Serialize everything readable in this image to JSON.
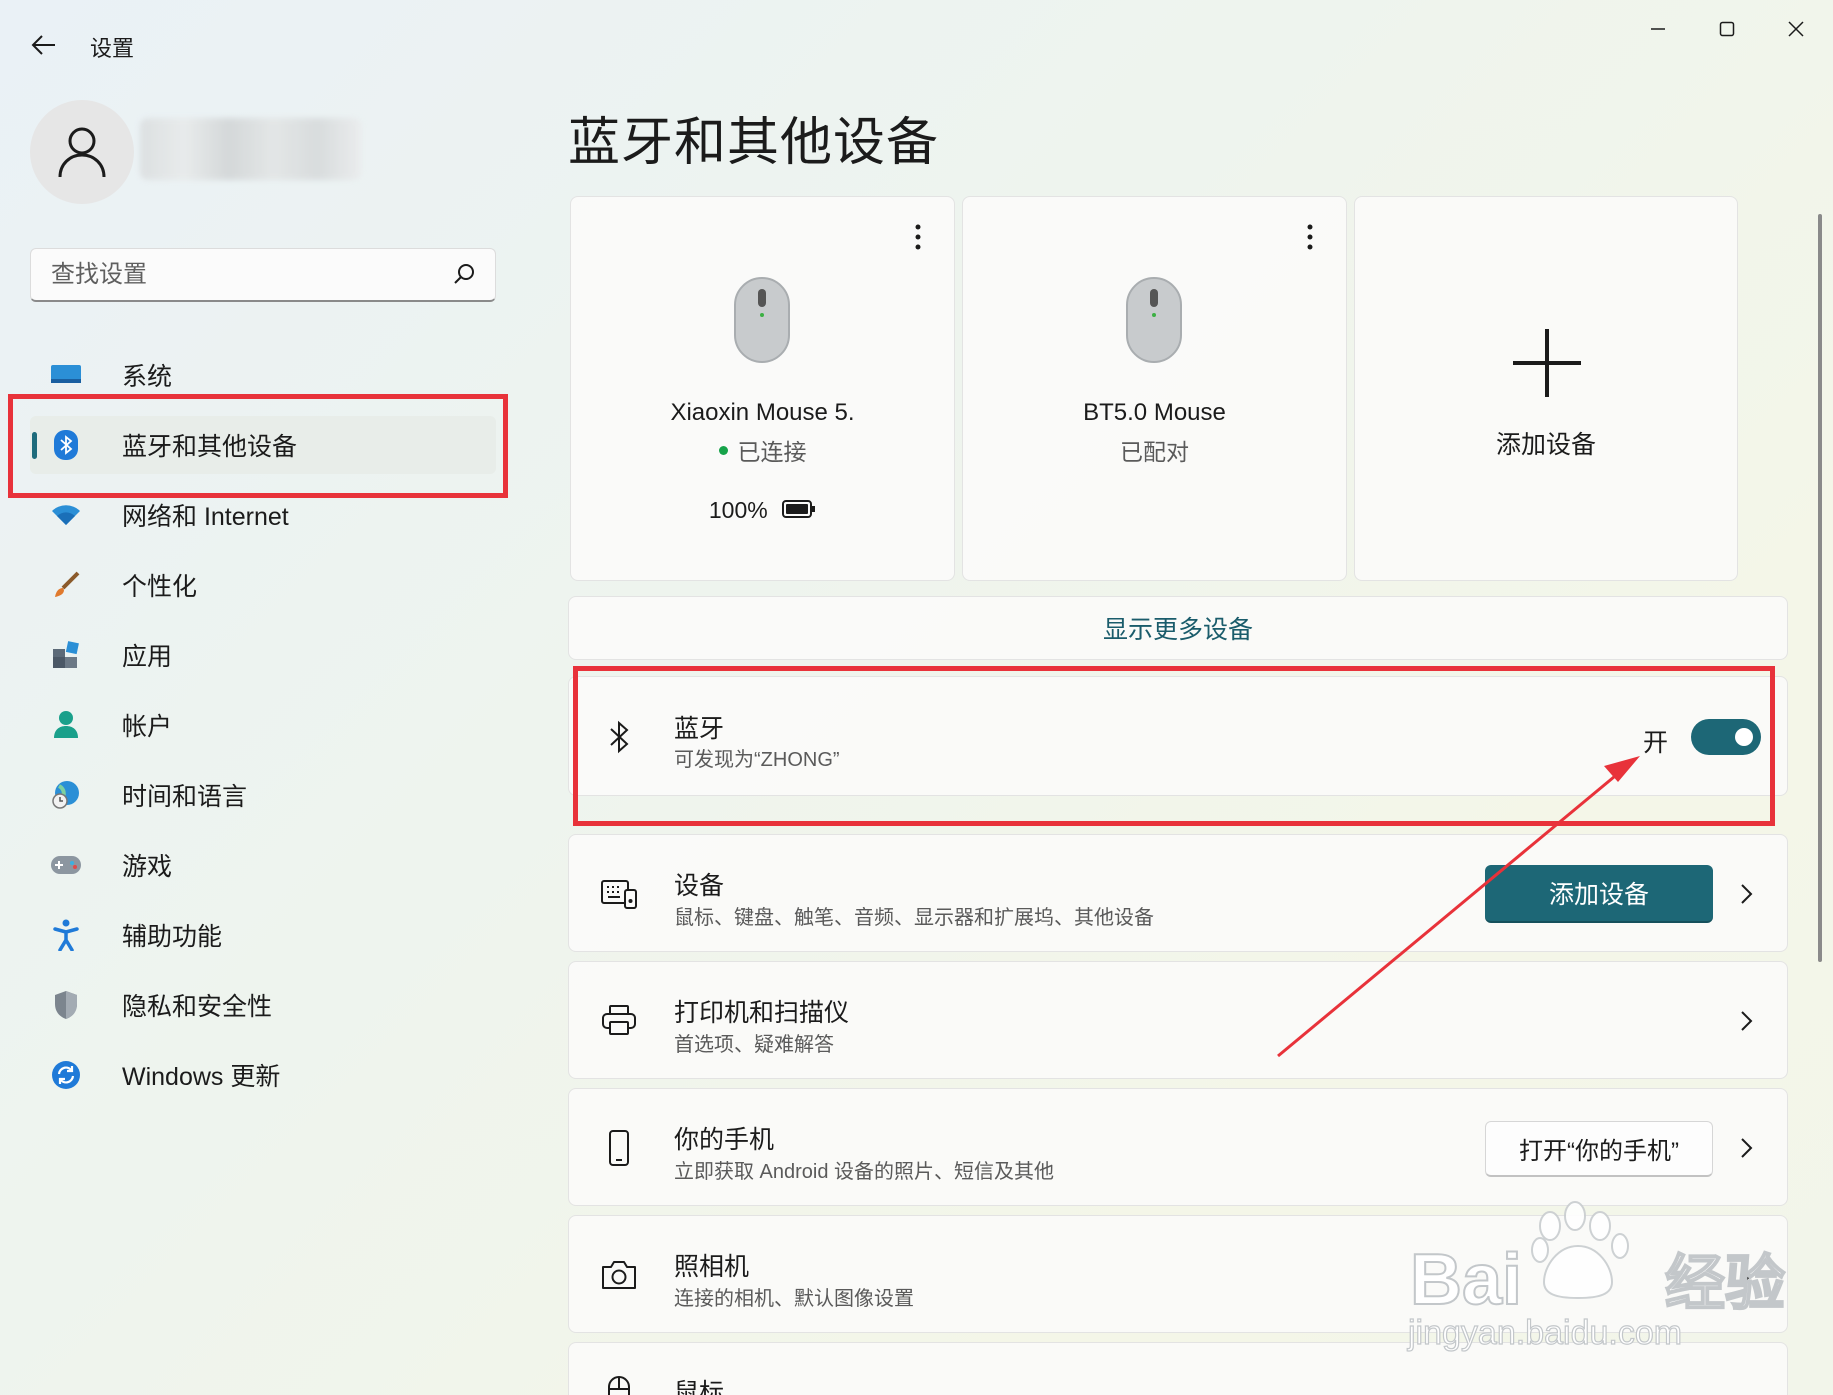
{
  "window": {
    "app_title": "设置",
    "back_icon": "arrow-left-icon",
    "controls": [
      "minimize-icon",
      "maximize-icon",
      "close-icon"
    ]
  },
  "user": {
    "avatar_icon": "person-icon"
  },
  "search": {
    "placeholder": "查找设置",
    "icon": "search-icon"
  },
  "sidebar": {
    "items": [
      {
        "label": "系统",
        "icon": "monitor-icon"
      },
      {
        "label": "蓝牙和其他设备",
        "icon": "bluetooth-icon",
        "active": true
      },
      {
        "label": "网络和 Internet",
        "icon": "wifi-icon"
      },
      {
        "label": "个性化",
        "icon": "brush-icon"
      },
      {
        "label": "应用",
        "icon": "apps-icon"
      },
      {
        "label": "帐户",
        "icon": "account-icon"
      },
      {
        "label": "时间和语言",
        "icon": "globe-clock-icon"
      },
      {
        "label": "游戏",
        "icon": "gamepad-icon"
      },
      {
        "label": "辅助功能",
        "icon": "accessibility-icon"
      },
      {
        "label": "隐私和安全性",
        "icon": "shield-icon"
      },
      {
        "label": "Windows 更新",
        "icon": "update-icon"
      }
    ]
  },
  "page": {
    "title": "蓝牙和其他设备"
  },
  "devices": [
    {
      "name": "Xiaoxin Mouse 5.",
      "status": "已连接",
      "battery": "100%",
      "status_dot_color": "#16a34a",
      "icon": "mouse-icon"
    },
    {
      "name": "BT5.0 Mouse",
      "status": "已配对",
      "icon": "mouse-icon"
    }
  ],
  "add_device_tile": {
    "label": "添加设备",
    "icon": "plus-icon"
  },
  "show_more": {
    "label": "显示更多设备"
  },
  "bluetooth": {
    "title": "蓝牙",
    "subtitle": "可发现为“ZHONG”",
    "state_label": "开",
    "on": true,
    "icon": "bluetooth-icon"
  },
  "rows": [
    {
      "title": "设备",
      "subtitle": "鼠标、键盘、触笔、音频、显示器和扩展坞、其他设备",
      "button": "添加设备",
      "icon": "keyboard-icon"
    },
    {
      "title": "打印机和扫描仪",
      "subtitle": "首选项、疑难解答",
      "icon": "printer-icon"
    },
    {
      "title": "你的手机",
      "subtitle": "立即获取 Android 设备的照片、短信及其他",
      "button": "打开“你的手机”",
      "icon": "phone-icon"
    },
    {
      "title": "照相机",
      "subtitle": "连接的相机、默认图像设置",
      "icon": "camera-icon"
    },
    {
      "title": "鼠标",
      "icon": "mouse-icon"
    }
  ],
  "colors": {
    "accent": "#1d6776",
    "annotation_red": "#e8323a"
  },
  "watermark": {
    "brand": "Baidu经验",
    "url": "jingyan.baidu.com"
  }
}
